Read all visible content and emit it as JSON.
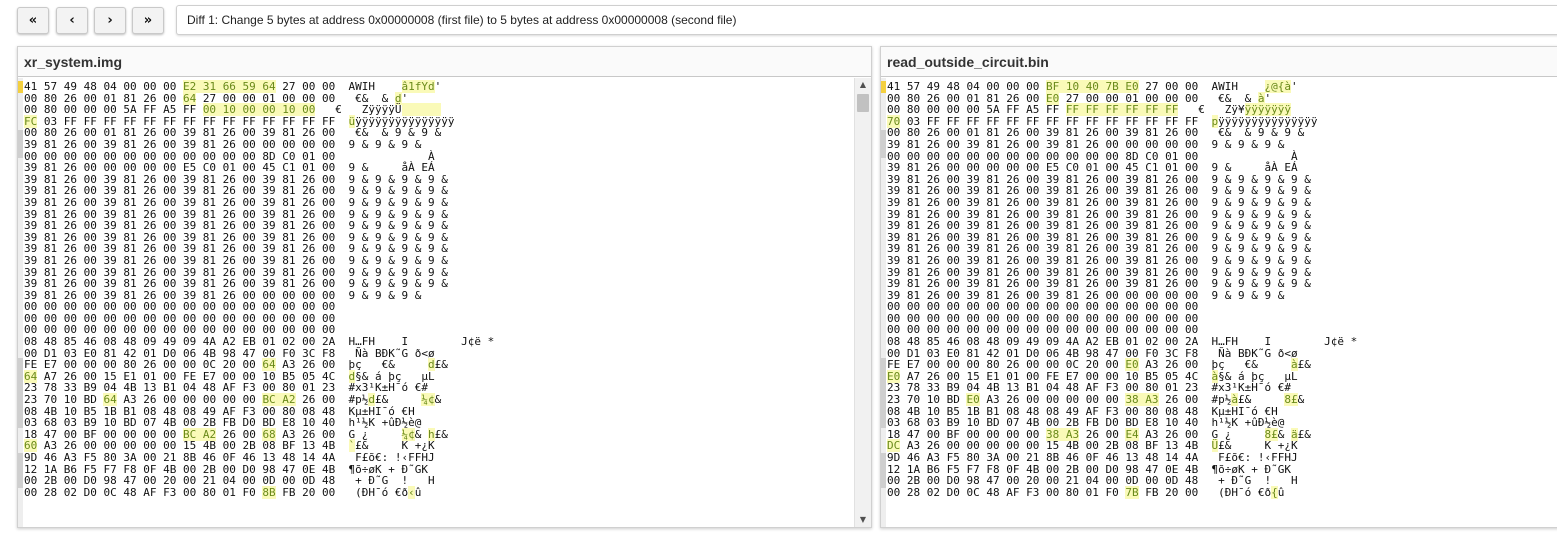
{
  "nav": {
    "first_label": "«",
    "prev_label": "‹",
    "next_label": "›",
    "last_label": "»"
  },
  "diff_summary": "Diff 1: Change 5 bytes at address 0x00000008 (first file) to 5 bytes at address 0x00000008 (second file)",
  "colors": {
    "highlight_bg": "#fafab8",
    "cursor": "#f4d03f"
  },
  "panels": [
    {
      "file_name": "xr_system.img",
      "lines": [
        [
          [
            "41 57 49 48 04 00 00 00 ",
            0
          ],
          [
            "E2 31 66 59 64",
            1
          ],
          [
            " 27 00 00  AWIH    ",
            0
          ],
          [
            "â1fYd",
            1
          ],
          [
            "'",
            0
          ]
        ],
        [
          [
            "00 80 26 00 01 81 26 00 ",
            0
          ],
          [
            "64",
            1
          ],
          [
            " 27 00 00 01 00 00 00   €&  & ",
            0
          ],
          [
            "d",
            1
          ],
          [
            "'",
            0
          ]
        ],
        [
          [
            "00 80 00 00 00 5A FF A5 FF ",
            0
          ],
          [
            "00 10 00 00 10 00",
            1
          ],
          [
            "   €   ZÿÿÿÿÜ",
            0
          ],
          [
            "      ",
            1
          ]
        ],
        [
          [
            "FC",
            1
          ],
          [
            " 03 FF FF FF FF FF FF FF FF FF FF FF FF FF FF  ",
            0
          ],
          [
            "ü",
            1
          ],
          [
            "ÿÿÿÿÿÿÿÿÿÿÿÿÿÿÿ",
            0
          ]
        ],
        [
          [
            "00 80 26 00 01 81 26 00 39 81 26 00 39 81 26 00   €&  & 9 & 9 &",
            0
          ]
        ],
        [
          [
            "39 81 26 00 39 81 26 00 39 81 26 00 00 00 00 00  9 & 9 & 9 &",
            0
          ]
        ],
        [
          [
            "00 00 00 00 00 00 00 00 00 00 00 00 8D C0 01 00              À",
            0
          ]
        ],
        [
          [
            "39 81 26 00 00 00 00 00 E5 C0 01 00 45 C1 01 00  9 &     åÀ EÁ",
            0
          ]
        ],
        [
          [
            "39 81 26 00 39 81 26 00 39 81 26 00 39 81 26 00  9 & 9 & 9 & 9 &",
            0
          ]
        ],
        [
          [
            "39 81 26 00 39 81 26 00 39 81 26 00 39 81 26 00  9 & 9 & 9 & 9 &",
            0
          ]
        ],
        [
          [
            "39 81 26 00 39 81 26 00 39 81 26 00 39 81 26 00  9 & 9 & 9 & 9 &",
            0
          ]
        ],
        [
          [
            "39 81 26 00 39 81 26 00 39 81 26 00 39 81 26 00  9 & 9 & 9 & 9 &",
            0
          ]
        ],
        [
          [
            "39 81 26 00 39 81 26 00 39 81 26 00 39 81 26 00  9 & 9 & 9 & 9 &",
            0
          ]
        ],
        [
          [
            "39 81 26 00 39 81 26 00 39 81 26 00 39 81 26 00  9 & 9 & 9 & 9 &",
            0
          ]
        ],
        [
          [
            "39 81 26 00 39 81 26 00 39 81 26 00 39 81 26 00  9 & 9 & 9 & 9 &",
            0
          ]
        ],
        [
          [
            "39 81 26 00 39 81 26 00 39 81 26 00 39 81 26 00  9 & 9 & 9 & 9 &",
            0
          ]
        ],
        [
          [
            "39 81 26 00 39 81 26 00 39 81 26 00 39 81 26 00  9 & 9 & 9 & 9 &",
            0
          ]
        ],
        [
          [
            "39 81 26 00 39 81 26 00 39 81 26 00 39 81 26 00  9 & 9 & 9 & 9 &",
            0
          ]
        ],
        [
          [
            "39 81 26 00 39 81 26 00 39 81 26 00 00 00 00 00  9 & 9 & 9 &",
            0
          ]
        ],
        [
          [
            "00 00 00 00 00 00 00 00 00 00 00 00 00 00 00 00",
            0
          ]
        ],
        [
          [
            "00 00 00 00 00 00 00 00 00 00 00 00 00 00 00 00",
            0
          ]
        ],
        [
          [
            "00 00 00 00 00 00 00 00 00 00 00 00 00 00 00 00",
            0
          ]
        ],
        [
          [
            "08 48 85 46 08 48 09 49 09 4A A2 EB 01 02 00 2A  H…FH    I        J¢ë *",
            0
          ]
        ],
        [
          [
            "00 D1 03 E0 81 42 01 D0 06 4B 98 47 00 F0 3C F8   Ñà BÐK˜G ð<ø",
            0
          ]
        ],
        [
          [
            "FE E7 00 00 00 80 26 00 00 0C 20 00 ",
            0
          ],
          [
            "64",
            1
          ],
          [
            " A3 26 00  þç   €&     ",
            0
          ],
          [
            "d",
            1
          ],
          [
            "£&",
            0
          ]
        ],
        [
          [
            "64",
            1
          ],
          [
            " A7 26 00 15 E1 01 00 FE E7 00 00 10 B5 05 4C  ",
            0
          ],
          [
            "d",
            1
          ],
          [
            "§& á þç   µL",
            0
          ]
        ],
        [
          [
            "23 78 33 B9 04 4B 13 B1 04 48 AF F3 00 80 01 23  #x3¹K±H¯ó €#",
            0
          ]
        ],
        [
          [
            "23 70 10 BD ",
            0
          ],
          [
            "64",
            1
          ],
          [
            " A3 26 00 00 00 00 00 ",
            0
          ],
          [
            "BC A2",
            1
          ],
          [
            " 26 00  #p½",
            0
          ],
          [
            "d",
            1
          ],
          [
            "£&     ",
            0
          ],
          [
            "¼¢",
            1
          ],
          [
            "&",
            0
          ]
        ],
        [
          [
            "08 4B 10 B5 1B B1 08 48 08 49 AF F3 00 80 08 48  Kµ±HI¯ó €H",
            0
          ]
        ],
        [
          [
            "03 68 03 B9 10 BD 07 4B 00 2B FB D0 BD E8 10 40  h¹½K +ûÐ½è@",
            0
          ]
        ],
        [
          [
            "18 47 00 BF 00 00 00 00 ",
            0
          ],
          [
            "BC A2",
            1
          ],
          [
            " 26 00 ",
            0
          ],
          [
            "68",
            1
          ],
          [
            " A3 26 00  G ¿     ",
            0
          ],
          [
            "¼¢",
            1
          ],
          [
            "& ",
            0
          ],
          [
            "h",
            1
          ],
          [
            "£&",
            0
          ]
        ],
        [
          [
            "60",
            1
          ],
          [
            " A3 26 00 00 00 00 00 15 4B 00 2B 08 BF 13 4B  ",
            0
          ],
          [
            "`",
            1
          ],
          [
            "£&     K +¿K",
            0
          ]
        ],
        [
          [
            "9D 46 A3 F5 80 3A 00 21 8B 46 0F 46 13 48 14 4A   F£õ€: !‹FFHJ",
            0
          ]
        ],
        [
          [
            "12 1A B6 F5 F7 F8 0F 4B 00 2B 00 D0 98 47 0E 4B  ¶õ÷øK + Ð˜GK",
            0
          ]
        ],
        [
          [
            "00 2B 00 D0 98 47 00 20 00 21 04 00 0D 00 0D 48   + Ð˜G  !   H",
            0
          ]
        ],
        [
          [
            "00 28 02 D0 0C 48 AF F3 00 80 01 F0 ",
            0
          ],
          [
            "8B",
            1
          ],
          [
            " FB 20 00   (ÐH¯ó €ð",
            0
          ],
          [
            "‹",
            1
          ],
          [
            "û",
            0
          ]
        ]
      ]
    },
    {
      "file_name": "read_outside_circuit.bin",
      "lines": [
        [
          [
            "41 57 49 48 04 00 00 00 ",
            0
          ],
          [
            "BF 10 40 7B E0",
            1
          ],
          [
            " 27 00 00  AWIH    ",
            0
          ],
          [
            "¿@{à",
            1
          ],
          [
            "'",
            0
          ]
        ],
        [
          [
            "00 80 26 00 01 81 26 00 ",
            0
          ],
          [
            "E0",
            1
          ],
          [
            " 27 00 00 01 00 00 00   €&  & ",
            0
          ],
          [
            "à",
            1
          ],
          [
            "'",
            0
          ]
        ],
        [
          [
            "00 80 00 00 00 5A FF A5 FF ",
            0
          ],
          [
            "FF FF FF FF FF FF",
            1
          ],
          [
            "   €   Zÿ¥",
            0
          ],
          [
            "ÿÿÿÿÿÿÿ",
            1
          ]
        ],
        [
          [
            "70",
            1
          ],
          [
            " 03 FF FF FF FF FF FF FF FF FF FF FF FF FF FF  ",
            0
          ],
          [
            "p",
            1
          ],
          [
            "ÿÿÿÿÿÿÿÿÿÿÿÿÿÿÿ",
            0
          ]
        ],
        [
          [
            "00 80 26 00 01 81 26 00 39 81 26 00 39 81 26 00   €&  & 9 & 9 &",
            0
          ]
        ],
        [
          [
            "39 81 26 00 39 81 26 00 39 81 26 00 00 00 00 00  9 & 9 & 9 &",
            0
          ]
        ],
        [
          [
            "00 00 00 00 00 00 00 00 00 00 00 00 8D C0 01 00              À",
            0
          ]
        ],
        [
          [
            "39 81 26 00 00 00 00 00 E5 C0 01 00 45 C1 01 00  9 &     åÀ EÁ",
            0
          ]
        ],
        [
          [
            "39 81 26 00 39 81 26 00 39 81 26 00 39 81 26 00  9 & 9 & 9 & 9 &",
            0
          ]
        ],
        [
          [
            "39 81 26 00 39 81 26 00 39 81 26 00 39 81 26 00  9 & 9 & 9 & 9 &",
            0
          ]
        ],
        [
          [
            "39 81 26 00 39 81 26 00 39 81 26 00 39 81 26 00  9 & 9 & 9 & 9 &",
            0
          ]
        ],
        [
          [
            "39 81 26 00 39 81 26 00 39 81 26 00 39 81 26 00  9 & 9 & 9 & 9 &",
            0
          ]
        ],
        [
          [
            "39 81 26 00 39 81 26 00 39 81 26 00 39 81 26 00  9 & 9 & 9 & 9 &",
            0
          ]
        ],
        [
          [
            "39 81 26 00 39 81 26 00 39 81 26 00 39 81 26 00  9 & 9 & 9 & 9 &",
            0
          ]
        ],
        [
          [
            "39 81 26 00 39 81 26 00 39 81 26 00 39 81 26 00  9 & 9 & 9 & 9 &",
            0
          ]
        ],
        [
          [
            "39 81 26 00 39 81 26 00 39 81 26 00 39 81 26 00  9 & 9 & 9 & 9 &",
            0
          ]
        ],
        [
          [
            "39 81 26 00 39 81 26 00 39 81 26 00 39 81 26 00  9 & 9 & 9 & 9 &",
            0
          ]
        ],
        [
          [
            "39 81 26 00 39 81 26 00 39 81 26 00 39 81 26 00  9 & 9 & 9 & 9 &",
            0
          ]
        ],
        [
          [
            "39 81 26 00 39 81 26 00 39 81 26 00 00 00 00 00  9 & 9 & 9 &",
            0
          ]
        ],
        [
          [
            "00 00 00 00 00 00 00 00 00 00 00 00 00 00 00 00",
            0
          ]
        ],
        [
          [
            "00 00 00 00 00 00 00 00 00 00 00 00 00 00 00 00",
            0
          ]
        ],
        [
          [
            "00 00 00 00 00 00 00 00 00 00 00 00 00 00 00 00",
            0
          ]
        ],
        [
          [
            "08 48 85 46 08 48 09 49 09 4A A2 EB 01 02 00 2A  H…FH    I        J¢ë *",
            0
          ]
        ],
        [
          [
            "00 D1 03 E0 81 42 01 D0 06 4B 98 47 00 F0 3C F8   Ñà BÐK˜G ð<ø",
            0
          ]
        ],
        [
          [
            "FE E7 00 00 00 80 26 00 00 0C 20 00 ",
            0
          ],
          [
            "E0",
            1
          ],
          [
            " A3 26 00  þç   €&     ",
            0
          ],
          [
            "à",
            1
          ],
          [
            "£&",
            0
          ]
        ],
        [
          [
            "E0",
            1
          ],
          [
            " A7 26 00 15 E1 01 00 FE E7 00 00 10 B5 05 4C  ",
            0
          ],
          [
            "à",
            1
          ],
          [
            "§& á þç   µL",
            0
          ]
        ],
        [
          [
            "23 78 33 B9 04 4B 13 B1 04 48 AF F3 00 80 01 23  #x3¹K±H¯ó €#",
            0
          ]
        ],
        [
          [
            "23 70 10 BD ",
            0
          ],
          [
            "E0",
            1
          ],
          [
            " A3 26 00 00 00 00 00 ",
            0
          ],
          [
            "38 A3",
            1
          ],
          [
            " 26 00  #p½",
            0
          ],
          [
            "à",
            1
          ],
          [
            "£&     ",
            0
          ],
          [
            "8£",
            1
          ],
          [
            "&",
            0
          ]
        ],
        [
          [
            "08 4B 10 B5 1B B1 08 48 08 49 AF F3 00 80 08 48  Kµ±HI¯ó €H",
            0
          ]
        ],
        [
          [
            "03 68 03 B9 10 BD 07 4B 00 2B FB D0 BD E8 10 40  h¹½K +ûÐ½è@",
            0
          ]
        ],
        [
          [
            "18 47 00 BF 00 00 00 00 ",
            0
          ],
          [
            "38 A3",
            1
          ],
          [
            " 26 00 ",
            0
          ],
          [
            "E4",
            1
          ],
          [
            " A3 26 00  G ¿     ",
            0
          ],
          [
            "8£",
            1
          ],
          [
            "& ",
            0
          ],
          [
            "ä",
            1
          ],
          [
            "£&",
            0
          ]
        ],
        [
          [
            "DC",
            1
          ],
          [
            " A3 26 00 00 00 00 00 15 4B 00 2B 08 BF 13 4B  ",
            0
          ],
          [
            "Ü",
            1
          ],
          [
            "£&     K +¿K",
            0
          ]
        ],
        [
          [
            "9D 46 A3 F5 80 3A 00 21 8B 46 0F 46 13 48 14 4A   F£õ€: !‹FFHJ",
            0
          ]
        ],
        [
          [
            "12 1A B6 F5 F7 F8 0F 4B 00 2B 00 D0 98 47 0E 4B  ¶õ÷øK + Ð˜GK",
            0
          ]
        ],
        [
          [
            "00 2B 00 D0 98 47 00 20 00 21 04 00 0D 00 0D 48   + Ð˜G  !   H",
            0
          ]
        ],
        [
          [
            "00 28 02 D0 0C 48 AF F3 00 80 01 F0 ",
            0
          ],
          [
            "7B",
            1
          ],
          [
            " FB 20 00   (ÐH¯ó €ð",
            0
          ],
          [
            "{",
            1
          ],
          [
            "û",
            0
          ]
        ]
      ]
    }
  ],
  "scrollbar": {
    "up_arrow": "▲",
    "down_arrow": "▼"
  }
}
